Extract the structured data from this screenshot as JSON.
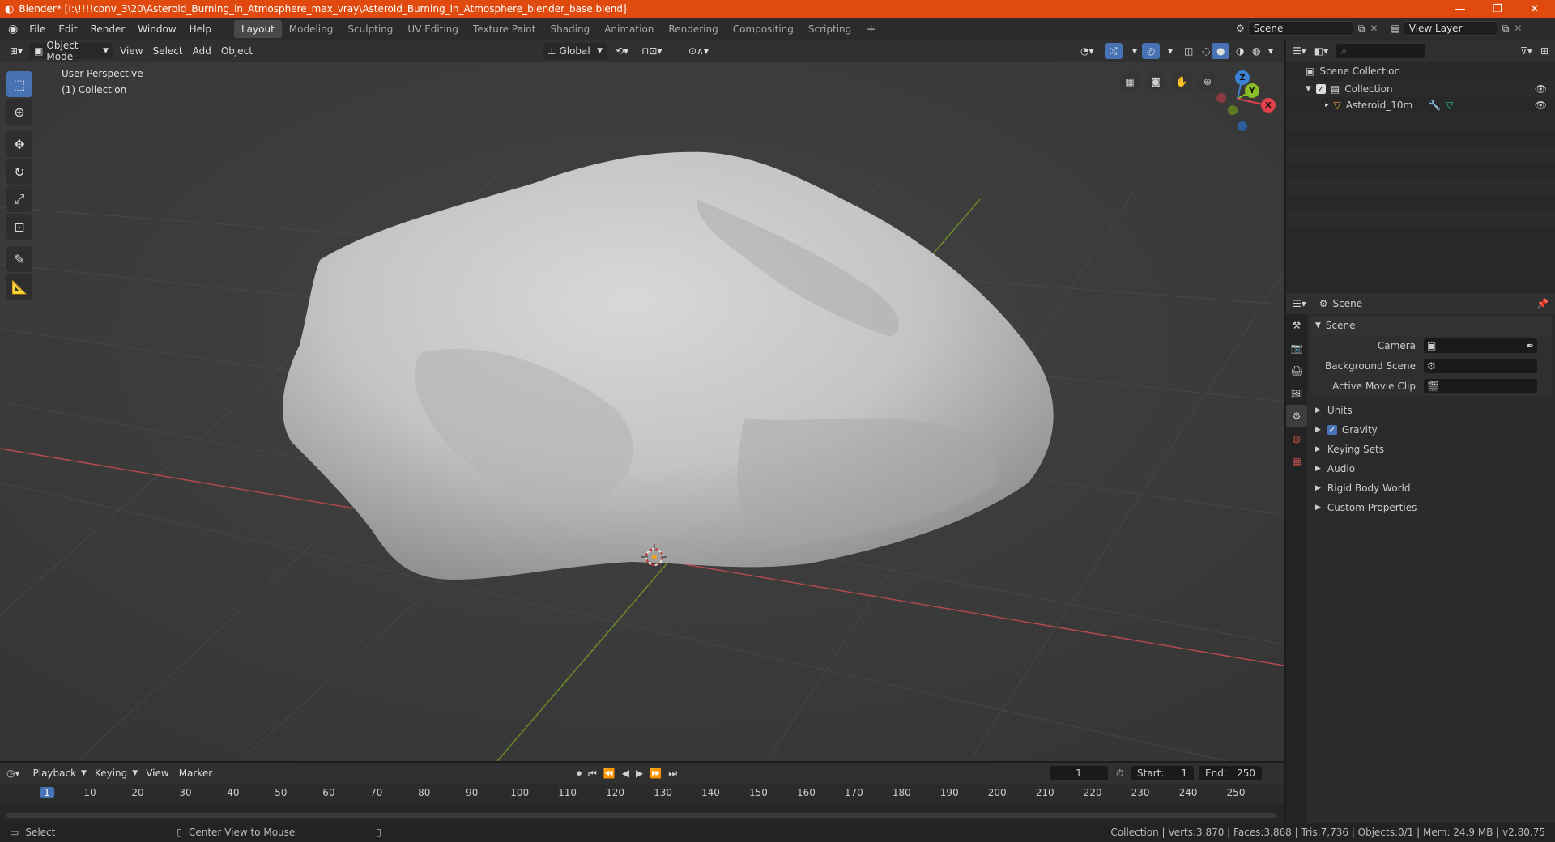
{
  "window": {
    "title": "Blender* [I:\\!!!!conv_3\\20\\Asteroid_Burning_in_Atmosphere_max_vray\\Asteroid_Burning_in_Atmosphere_blender_base.blend]",
    "minimize": "—",
    "maximize": "❐",
    "close": "✕"
  },
  "menu": [
    "File",
    "Edit",
    "Render",
    "Window",
    "Help"
  ],
  "workspaces": [
    "Layout",
    "Modeling",
    "Sculpting",
    "UV Editing",
    "Texture Paint",
    "Shading",
    "Animation",
    "Rendering",
    "Compositing",
    "Scripting"
  ],
  "scene_selector": "Scene",
  "view_layer": "View Layer",
  "viewport": {
    "mode": "Object Mode",
    "menus": [
      "View",
      "Select",
      "Add",
      "Object"
    ],
    "orientation": "Global",
    "overlay_title": "User Perspective",
    "overlay_sub": "(1) Collection"
  },
  "gizmo": {
    "x": "X",
    "y": "Y",
    "z": "Z"
  },
  "outliner": {
    "root": "Scene Collection",
    "collection": "Collection",
    "object": "Asteroid_10m",
    "search_placeholder": ""
  },
  "properties": {
    "header": "Scene",
    "section": "Scene",
    "camera_label": "Camera",
    "bg_label": "Background Scene",
    "clip_label": "Active Movie Clip",
    "panels": [
      "Units",
      "Gravity",
      "Keying Sets",
      "Audio",
      "Rigid Body World",
      "Custom Properties"
    ]
  },
  "timeline": {
    "menus": [
      "Playback",
      "Keying",
      "View",
      "Marker"
    ],
    "current_frame": "1",
    "start_label": "Start:",
    "start": "1",
    "end_label": "End:",
    "end": "250",
    "ticks": [
      "1",
      "10",
      "20",
      "30",
      "40",
      "50",
      "60",
      "70",
      "80",
      "90",
      "100",
      "110",
      "120",
      "130",
      "140",
      "150",
      "160",
      "170",
      "180",
      "190",
      "200",
      "210",
      "220",
      "230",
      "240",
      "250"
    ]
  },
  "status": {
    "left": "Select",
    "middle": "Center View to Mouse",
    "stats": "Collection | Verts:3,870 | Faces:3,868 | Tris:7,736 | Objects:0/1 | Mem: 24.9 MB | v2.80.75"
  },
  "colors": {
    "title_bar": "#e04a0e",
    "active_tool": "#4772b3",
    "x_axis": "#e0414c",
    "y_axis": "#8cbb28",
    "z_axis": "#3b82d4"
  }
}
